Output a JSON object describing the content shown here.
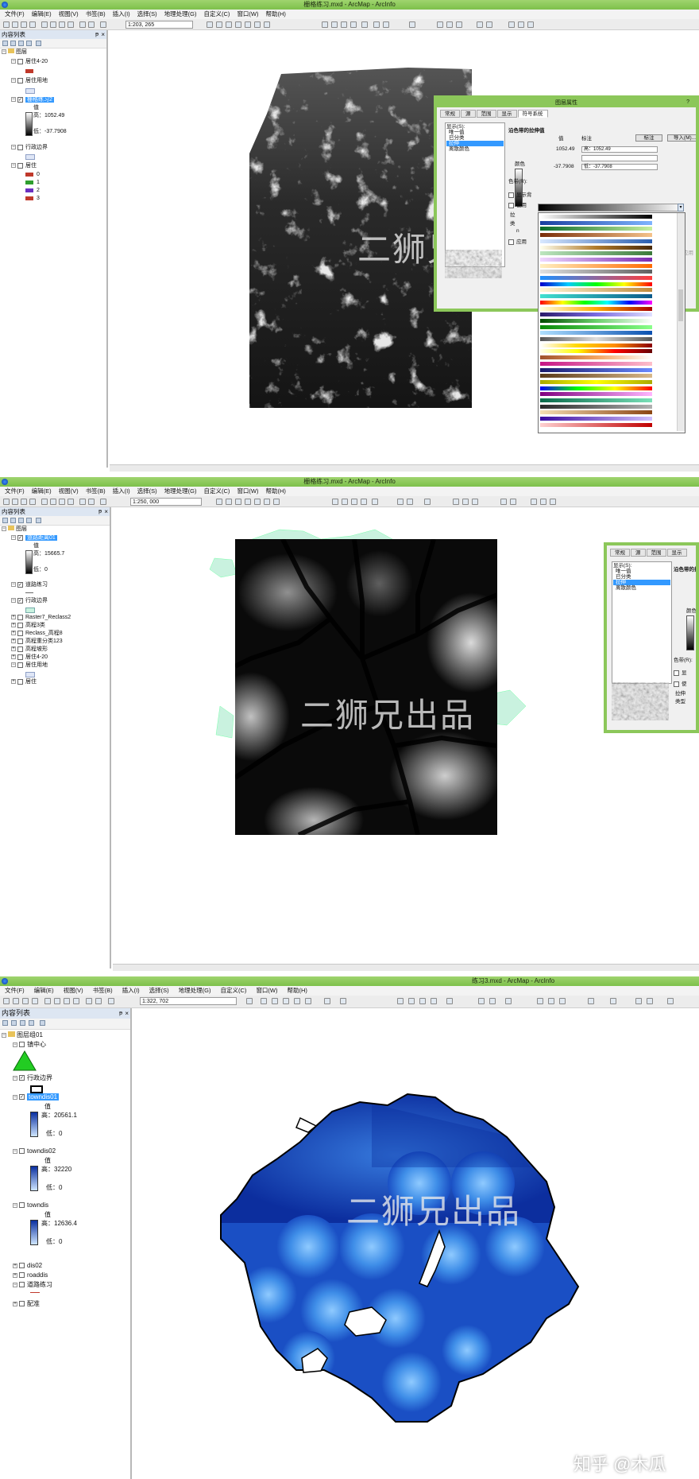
{
  "screens": [
    {
      "title": "栅格练习.mxd - ArcMap - ArcInfo",
      "menu": [
        "文件(F)",
        "编辑(E)",
        "视图(V)",
        "书签(B)",
        "插入(I)",
        "选择(S)",
        "地理处理(G)",
        "自定义(C)",
        "窗口(W)",
        "帮助(H)"
      ],
      "scale": "1:203, 265",
      "toc_title": "内容列表",
      "toc_root": "图层",
      "layers": {
        "l1": "居住4-20",
        "l2": "居住用地",
        "l3": "栅格练习2",
        "l3_value": "值",
        "l3_high": "高：1052.49",
        "l3_low": "低：-37.7908",
        "l4": "行政边界",
        "l5": "居住",
        "l5_c0": "0",
        "l5_c1": "1",
        "l5_c2": "2",
        "l5_c3": "3"
      },
      "dialog": {
        "title": "图层属性",
        "help": "?",
        "tabs": [
          "常规",
          "源",
          "范围",
          "显示",
          "符号系统"
        ],
        "list_title": "显示(S):",
        "list": [
          "唯一值",
          "已分类",
          "拉伸",
          "离散颜色"
        ],
        "list_selected": "拉伸",
        "heading": "沿色带的拉伸值",
        "col_color": "颜色",
        "col_value": "值",
        "col_label": "标注",
        "label_btn": "标注",
        "import_btn": "导入(M)...",
        "val_high": "1052.49",
        "label_high": "高：1052.49",
        "val_low": "-37.7908",
        "label_low": "低：-37.7908",
        "ramp_label": "色带(R):",
        "opt_a": "显示背",
        "opt_b": "使用",
        "opt_c": "拉",
        "opt_d": "类",
        "opt_e": "n",
        "opt_f": "应用",
        "apply": "应用"
      }
    },
    {
      "title": "栅格练习.mxd - ArcMap - ArcInfo",
      "menu": [
        "文件(F)",
        "编辑(E)",
        "视图(V)",
        "书签(B)",
        "插入(I)",
        "选择(S)",
        "地理处理(G)",
        "自定义(C)",
        "窗口(W)",
        "帮助(H)"
      ],
      "scale": "1:250, 000",
      "toc_title": "内容列表",
      "toc_root": "图层",
      "layers": {
        "l1": "道路距离01",
        "l1_value": "值",
        "l1_high": "高：15665.7",
        "l1_low": "低：0",
        "l2": "道路练习",
        "l3": "行政边界",
        "l4": "Raster7_Reclass2",
        "l5": "高程3类",
        "l6": "Reclass_高程8",
        "l7": "高程重分类123",
        "l8": "高程坡形",
        "l9": "居住4-20",
        "l10": "居住用地",
        "l11": "居住"
      },
      "dialog": {
        "tabs": [
          "常规",
          "源",
          "范围",
          "显示"
        ],
        "list_title": "显示(S):",
        "list": [
          "唯一值",
          "已分类",
          "拉伸",
          "离散颜色"
        ],
        "list_selected": "拉伸",
        "heading": "沿色带的拉",
        "col_color": "颜色",
        "ramp_label": "色带(R):",
        "opt_a": "显",
        "opt_b": "使",
        "opt_c": "拉伸",
        "opt_d": "类型"
      }
    },
    {
      "title": "练习3.mxd - ArcMap - ArcInfo",
      "menu": [
        "文件(F)",
        "编辑(E)",
        "视图(V)",
        "书签(B)",
        "插入(I)",
        "选择(S)",
        "地理处理(G)",
        "自定义(C)",
        "窗口(W)",
        "帮助(H)"
      ],
      "scale": "1:322, 702",
      "toc_title": "内容列表",
      "toc_root": "图层组01",
      "layers": {
        "l1": "镇中心",
        "l2": "行政边界",
        "l3": "towndis01",
        "l3_value": "值",
        "l3_high": "高：20561.1",
        "l3_low": "低：0",
        "l4": "towndis02",
        "l4_value": "值",
        "l4_high": "高：32220",
        "l4_low": "低：0",
        "l5": "towndis",
        "l5_value": "值",
        "l5_high": "高：12636.4",
        "l5_low": "低：0",
        "l6": "dis02",
        "l7": "roaddis",
        "l8": "道路练习",
        "l9": "配准"
      }
    }
  ],
  "watermark": "二狮兄出品",
  "brand": "知乎 @木瓜",
  "colors": {
    "titlebar": "#8cc75a",
    "selection": "#3399ff",
    "class0": "#c0392b",
    "class1": "#2e9e2e",
    "class2": "#6b2fc0",
    "class3": "#c0392b",
    "boundary_fill": "#c9f2df",
    "town_triangle": "#22cc22"
  },
  "icons": [
    "app-globe-icon",
    "expand-icon",
    "collapse-icon",
    "checkbox-icon",
    "pin-icon",
    "close-icon",
    "scrollbar-icon"
  ]
}
